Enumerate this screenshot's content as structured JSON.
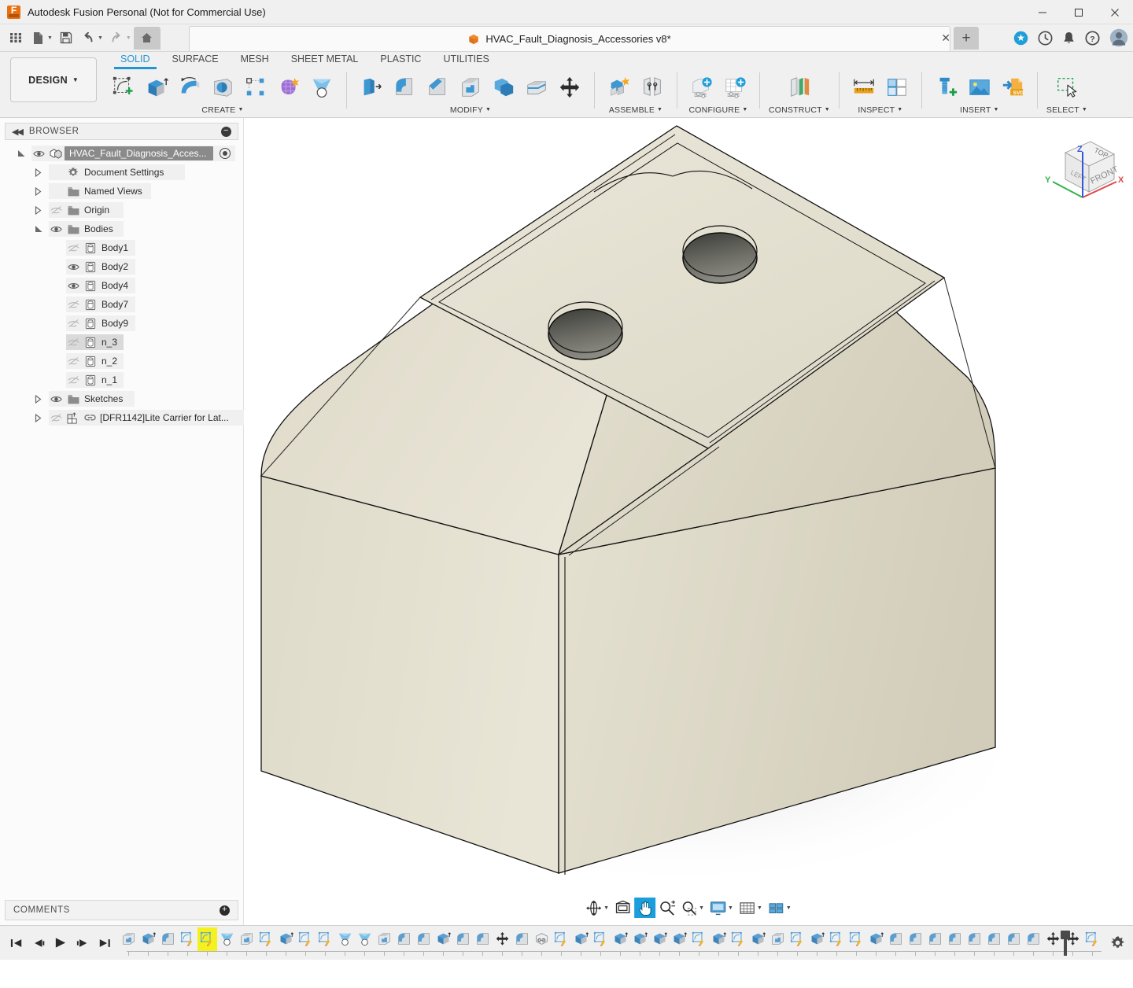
{
  "window": {
    "title": "Autodesk Fusion Personal (Not for Commercial Use)",
    "app_icon": "fusion-logo-icon",
    "minimize": "—",
    "maximize": "□",
    "close": "✕"
  },
  "quick_access": {
    "buttons": [
      {
        "name": "app-grid-button",
        "icon": "grid-icon"
      },
      {
        "name": "new-file-button",
        "icon": "file-icon"
      },
      {
        "name": "save-button",
        "icon": "save-icon"
      },
      {
        "name": "undo-button",
        "icon": "undo-icon"
      },
      {
        "name": "redo-button",
        "icon": "redo-icon"
      },
      {
        "name": "home-button",
        "icon": "home-icon"
      }
    ],
    "document_tab": {
      "label": "HVAC_Fault_Diagnosis_Accessories v8*",
      "icon": "orange-cube-icon",
      "close_label": "✕"
    },
    "new_tab_label": "+",
    "right_icons": [
      {
        "name": "extension-badge-icon",
        "glyph": "✦"
      },
      {
        "name": "job-status-clock-icon",
        "glyph": "◷"
      },
      {
        "name": "notifications-bell-icon",
        "glyph": "🔔"
      },
      {
        "name": "help-icon",
        "glyph": "?"
      },
      {
        "name": "user-avatar",
        "glyph": "👤"
      }
    ]
  },
  "ribbon": {
    "workspace_label": "DESIGN",
    "tabs": [
      {
        "label": "SOLID",
        "selected": true
      },
      {
        "label": "SURFACE",
        "selected": false
      },
      {
        "label": "MESH",
        "selected": false
      },
      {
        "label": "SHEET METAL",
        "selected": false
      },
      {
        "label": "PLASTIC",
        "selected": false
      },
      {
        "label": "UTILITIES",
        "selected": false
      }
    ],
    "groups": [
      {
        "label": "CREATE",
        "dropdown": true,
        "tools": [
          "create-sketch-icon",
          "extrude-icon",
          "revolve-icon",
          "sweep-icon",
          "pattern-icon",
          "form-icon",
          "loft-icon"
        ]
      },
      {
        "label": "MODIFY",
        "dropdown": true,
        "tools": [
          "press-pull-icon",
          "fillet-icon",
          "chamfer-icon",
          "shell-icon",
          "combine-icon",
          "split-face-icon",
          "move-copy-icon"
        ]
      },
      {
        "label": "ASSEMBLE",
        "dropdown": true,
        "tools": [
          "new-component-icon",
          "joint-icon"
        ]
      },
      {
        "label": "CONFIGURE",
        "dropdown": true,
        "tools": [
          "configuration-icon",
          "configuration-table-icon"
        ]
      },
      {
        "label": "CONSTRUCT",
        "dropdown": true,
        "tools": [
          "offset-plane-icon"
        ]
      },
      {
        "label": "INSPECT",
        "dropdown": true,
        "tools": [
          "measure-icon",
          "section-analysis-icon"
        ]
      },
      {
        "label": "INSERT",
        "dropdown": true,
        "tools": [
          "insert-mcmaster-icon",
          "insert-canvas-icon",
          "insert-svg-icon"
        ]
      },
      {
        "label": "SELECT",
        "dropdown": true,
        "tools": [
          "select-window-icon"
        ]
      }
    ]
  },
  "browser": {
    "header_label": "BROWSER",
    "collapse_icon": "collapse-left-icon",
    "minimize_icon": "minus-circle-icon",
    "tree": [
      {
        "label": "HVAC_Fault_Diagnosis_Acces...",
        "icon": "component-icon",
        "indent": 0,
        "expander": "expanded",
        "visible": true,
        "root": true,
        "has_activate_dot": true
      },
      {
        "label": "Document Settings",
        "icon": "gear-icon",
        "indent": 1,
        "expander": "collapsed",
        "visible": null
      },
      {
        "label": "Named Views",
        "icon": "folder-icon",
        "indent": 1,
        "expander": "collapsed",
        "visible": null
      },
      {
        "label": "Origin",
        "icon": "folder-icon",
        "indent": 1,
        "expander": "collapsed",
        "visible": false
      },
      {
        "label": "Bodies",
        "icon": "folder-icon",
        "indent": 1,
        "expander": "expanded",
        "visible": true
      },
      {
        "label": "Body1",
        "icon": "body-icon",
        "indent": 2,
        "expander": "none",
        "visible": false
      },
      {
        "label": "Body2",
        "icon": "body-icon",
        "indent": 2,
        "expander": "none",
        "visible": true
      },
      {
        "label": "Body4",
        "icon": "body-icon",
        "indent": 2,
        "expander": "none",
        "visible": true
      },
      {
        "label": "Body7",
        "icon": "body-icon",
        "indent": 2,
        "expander": "none",
        "visible": false
      },
      {
        "label": "Body9",
        "icon": "body-icon",
        "indent": 2,
        "expander": "none",
        "visible": false
      },
      {
        "label": "n_3",
        "icon": "body-icon",
        "indent": 2,
        "expander": "none",
        "visible": false,
        "selected": true
      },
      {
        "label": "n_2",
        "icon": "body-icon",
        "indent": 2,
        "expander": "none",
        "visible": false
      },
      {
        "label": "n_1",
        "icon": "body-icon",
        "indent": 2,
        "expander": "none",
        "visible": false
      },
      {
        "label": "Sketches",
        "icon": "folder-icon",
        "indent": 1,
        "expander": "collapsed",
        "visible": true
      },
      {
        "label": "[DFR1142]Lite Carrier for Lat...",
        "icon": "linked-component-icon",
        "indent": 1,
        "expander": "collapsed",
        "visible": false,
        "link": true
      }
    ]
  },
  "comments": {
    "label": "COMMENTS",
    "add_icon": "plus-circle-icon"
  },
  "canvas": {
    "model_color": "#ddd8c6",
    "model_color_light": "#e6e2d2",
    "model_color_dark": "#cfcab6",
    "edge_color": "#1a1a1a",
    "hole_color": "#555550",
    "background": "#ffffff",
    "viewcube": {
      "faces": [
        "TOP",
        "LEFT",
        "FRONT"
      ],
      "axes": [
        {
          "label": "X",
          "color": "#e2484d"
        },
        {
          "label": "Y",
          "color": "#33b44a"
        },
        {
          "label": "Z",
          "color": "#3355dd"
        }
      ]
    },
    "navbar": [
      {
        "name": "orbit-button",
        "icon": "orbit-icon",
        "dropdown": true,
        "active": false
      },
      {
        "name": "look-at-button",
        "icon": "look-at-icon",
        "dropdown": false,
        "active": false
      },
      {
        "name": "pan-button",
        "icon": "pan-hand-icon",
        "dropdown": false,
        "active": true
      },
      {
        "name": "zoom-button",
        "icon": "zoom-icon",
        "dropdown": false,
        "active": false
      },
      {
        "name": "fit-button",
        "icon": "fit-icon",
        "dropdown": true,
        "active": false
      },
      {
        "name": "display-settings-button",
        "icon": "monitor-icon",
        "dropdown": true,
        "active": false
      },
      {
        "name": "grid-snaps-button",
        "icon": "grid-icon",
        "dropdown": true,
        "active": false
      },
      {
        "name": "viewports-button",
        "icon": "viewports-icon",
        "dropdown": true,
        "active": false
      }
    ]
  },
  "timeline": {
    "playback": [
      {
        "name": "go-to-beginning-button",
        "icon": "skip-back-icon"
      },
      {
        "name": "step-back-button",
        "icon": "step-back-icon"
      },
      {
        "name": "play-button",
        "icon": "play-icon"
      },
      {
        "name": "step-forward-button",
        "icon": "step-forward-icon"
      },
      {
        "name": "go-to-end-button",
        "icon": "skip-forward-icon"
      }
    ],
    "settings_icon": "gear-icon",
    "features": [
      {
        "icon": "shell-icon"
      },
      {
        "icon": "extrude-icon"
      },
      {
        "icon": "fillet-icon"
      },
      {
        "icon": "sketch-icon"
      },
      {
        "icon": "sketch-icon",
        "highlighted": true
      },
      {
        "icon": "loft-icon"
      },
      {
        "icon": "shell-icon"
      },
      {
        "icon": "sketch-icon"
      },
      {
        "icon": "extrude-icon"
      },
      {
        "icon": "sketch-icon"
      },
      {
        "icon": "sketch-icon"
      },
      {
        "icon": "loft-icon"
      },
      {
        "icon": "loft-icon"
      },
      {
        "icon": "shell-icon"
      },
      {
        "icon": "fillet-icon"
      },
      {
        "icon": "fillet-icon"
      },
      {
        "icon": "extrude-icon"
      },
      {
        "icon": "fillet-icon"
      },
      {
        "icon": "fillet-icon"
      },
      {
        "icon": "move-icon"
      },
      {
        "icon": "fillet-icon"
      },
      {
        "icon": "link-icon"
      },
      {
        "icon": "sketch-icon"
      },
      {
        "icon": "extrude-icon"
      },
      {
        "icon": "sketch-icon"
      },
      {
        "icon": "extrude-icon"
      },
      {
        "icon": "extrude-icon"
      },
      {
        "icon": "extrude-icon"
      },
      {
        "icon": "extrude-icon"
      },
      {
        "icon": "sketch-icon"
      },
      {
        "icon": "extrude-icon"
      },
      {
        "icon": "sketch-icon"
      },
      {
        "icon": "extrude-icon"
      },
      {
        "icon": "shell-icon"
      },
      {
        "icon": "sketch-icon"
      },
      {
        "icon": "extrude-icon"
      },
      {
        "icon": "sketch-icon"
      },
      {
        "icon": "sketch-icon"
      },
      {
        "icon": "extrude-icon"
      },
      {
        "icon": "fillet-icon"
      },
      {
        "icon": "fillet-icon"
      },
      {
        "icon": "fillet-icon"
      },
      {
        "icon": "fillet-icon"
      },
      {
        "icon": "fillet-icon"
      },
      {
        "icon": "fillet-icon"
      },
      {
        "icon": "fillet-icon"
      },
      {
        "icon": "fillet-icon"
      },
      {
        "icon": "move-icon"
      },
      {
        "icon": "move-icon"
      },
      {
        "icon": "sketch-icon"
      },
      {
        "icon": "extrude-icon"
      },
      {
        "icon": "sketch-icon"
      },
      {
        "icon": "extrude-icon"
      }
    ]
  }
}
